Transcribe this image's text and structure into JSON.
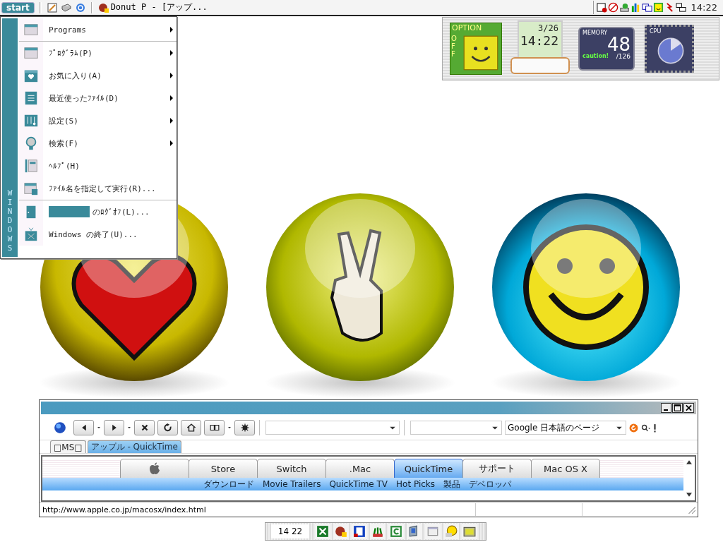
{
  "taskbar": {
    "start_label": "start",
    "task_title": "Donut P - [アップ...",
    "clock": "14:22"
  },
  "widgets": {
    "option": {
      "label": "OPTION",
      "state": "OFF"
    },
    "calendar": {
      "date": "3/26",
      "time": "14:22"
    },
    "memory": {
      "label": "MEMORY",
      "value": "48",
      "total": "/126",
      "warning": "caution!"
    },
    "cpu": {
      "label": "CPU"
    }
  },
  "start_menu": {
    "side_label": "WINDOWS",
    "items": [
      {
        "kind": "window",
        "label": "Programs",
        "submenu": true,
        "separator_after": true
      },
      {
        "kind": "window",
        "label": "ﾌﾟﾛｸﾞﾗﾑ(P)",
        "submenu": true,
        "separator_after": false
      },
      {
        "kind": "heart",
        "label": "お気に入り(A)",
        "submenu": true,
        "separator_after": false
      },
      {
        "kind": "document",
        "label": "最近使ったﾌｧｲﾙ(D)",
        "submenu": true,
        "separator_after": false
      },
      {
        "kind": "settings",
        "label": "設定(S)",
        "submenu": true,
        "separator_after": false
      },
      {
        "kind": "search",
        "label": "検索(F)",
        "submenu": true,
        "separator_after": false
      },
      {
        "kind": "help",
        "label": "ﾍﾙﾌﾟ(H)",
        "submenu": false,
        "separator_after": false
      },
      {
        "kind": "run",
        "label": "ﾌｧｲﾙ名を指定して実行(R)...",
        "submenu": false,
        "separator_after": true
      },
      {
        "kind": "logoff",
        "label": "のﾛｸﾞｵﾌ(L)...",
        "submenu": false,
        "separator_after": false
      },
      {
        "kind": "shutdown",
        "label": "Windows の終了(U)...",
        "submenu": false,
        "separator_after": false
      }
    ]
  },
  "orbs": [
    {
      "kind": "heart"
    },
    {
      "kind": "peace"
    },
    {
      "kind": "smile"
    }
  ],
  "browser": {
    "search_engine": "Google 日本語のページ",
    "tabs": [
      {
        "label": "□MS□",
        "selected": false
      },
      {
        "label": "アップル - QuickTime",
        "selected": true
      }
    ],
    "site_tabs": [
      {
        "kind": "logo",
        "selected": false
      },
      {
        "kind": "text",
        "label": "Store",
        "selected": false
      },
      {
        "kind": "text",
        "label": "Switch",
        "selected": false
      },
      {
        "kind": "text",
        "label": ".Mac",
        "selected": false
      },
      {
        "kind": "text",
        "label": "QuickTime",
        "selected": true
      },
      {
        "kind": "text",
        "label": "サポート",
        "selected": false
      },
      {
        "kind": "text",
        "label": "Mac OS X",
        "selected": false
      }
    ],
    "sub_links": [
      "ダウンロード",
      "Movie Trailers",
      "QuickTime TV",
      "Hot Picks",
      "製品",
      "デベロッパ"
    ],
    "status_url": "http://www.apple.co.jp/macosx/index.html"
  },
  "dock": {
    "clock": "14 22"
  }
}
